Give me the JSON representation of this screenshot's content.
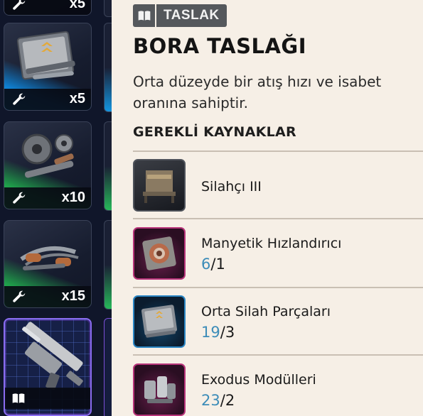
{
  "inventory": {
    "items": [
      {
        "qty": "x5",
        "accent": "none"
      },
      {
        "qty": "x5",
        "accent": "blue"
      },
      {
        "qty": "x10",
        "accent": "green"
      },
      {
        "qty": "x15",
        "accent": "green"
      },
      {
        "qty": "",
        "accent": "blueprint",
        "selected": true
      }
    ]
  },
  "detail": {
    "tag_icon": "book-icon",
    "tag_label": "TASLAK",
    "title": "BORA TASLAĞI",
    "description": "Orta düzeyde bir atış hızı ve isabet oranına sahiptir.",
    "section_title": "GEREKLİ KAYNAKLAR",
    "resources": [
      {
        "name": "Silahçı III",
        "have": "",
        "sep": "",
        "need": "",
        "rarity_color": "#4e525a"
      },
      {
        "name": "Manyetik Hızlandırıcı",
        "have": "6",
        "sep": "/",
        "need": "1",
        "rarity_color": "#b8347a"
      },
      {
        "name": "Orta Silah Parçaları",
        "have": "19",
        "sep": "/",
        "need": "3",
        "rarity_color": "#2a86c4"
      },
      {
        "name": "Exodus Modülleri",
        "have": "23",
        "sep": "/",
        "need": "2",
        "rarity_color": "#b8347a"
      }
    ]
  },
  "colors": {
    "panel_bg": "#f6efe6",
    "count_have": "#3c8cb8",
    "blue_accent": "#18a8f0",
    "green_accent": "#2fcf67",
    "blueprint_border": "#8a6cf0"
  }
}
